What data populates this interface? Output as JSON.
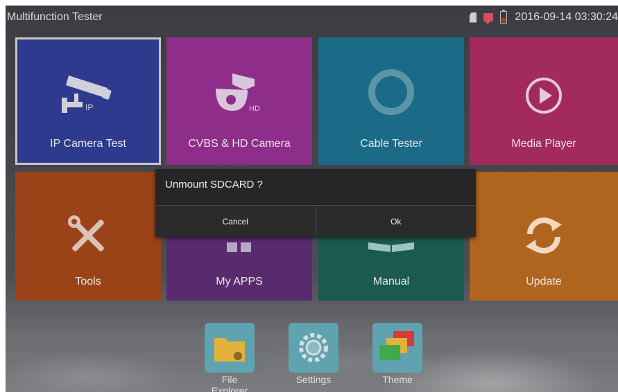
{
  "status_bar": {
    "app_title": "Multifunction Tester",
    "datetime": "2016-09-14 03:30:24",
    "icons": [
      "sdcard-icon",
      "message-icon",
      "battery-icon"
    ]
  },
  "tiles": [
    {
      "label": "IP Camera Test",
      "icon": "ip-camera-icon",
      "color": "#2d3a8d",
      "icon_badge": "IP",
      "selected": true
    },
    {
      "label": "CVBS & HD Camera",
      "icon": "ptz-camera-icon",
      "color": "#8f2d8a",
      "icon_badge": "HD"
    },
    {
      "label": "Cable Tester",
      "icon": "cable-coil-icon",
      "color": "#1b6b88"
    },
    {
      "label": "Media Player",
      "icon": "play-icon",
      "color": "#a22a5f"
    },
    {
      "label": "Tools",
      "icon": "tools-icon",
      "color": "#9b4318"
    },
    {
      "label": "My APPS",
      "icon": "apps-icon",
      "color": "#5a2a6e"
    },
    {
      "label": "Manual",
      "icon": "book-icon",
      "color": "#1a5a50"
    },
    {
      "label": "Update",
      "icon": "refresh-icon",
      "color": "#b0651e"
    }
  ],
  "dialog": {
    "message": "Unmount SDCARD ?",
    "cancel_label": "Cancel",
    "ok_label": "Ok"
  },
  "dock": [
    {
      "label": "File Explorer",
      "icon": "folder-icon"
    },
    {
      "label": "Settings",
      "icon": "gear-icon"
    },
    {
      "label": "Theme",
      "icon": "theme-icon"
    }
  ]
}
